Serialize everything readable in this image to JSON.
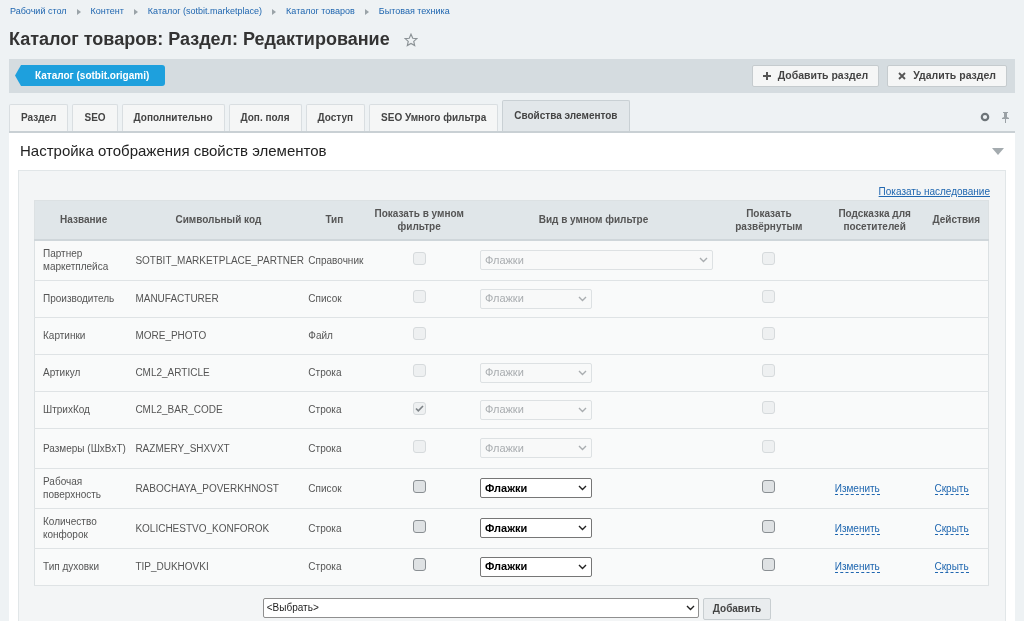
{
  "breadcrumbs": [
    "Рабочий стол",
    "Контент",
    "Каталог (sotbit.marketplace)",
    "Каталог товаров",
    "Бытовая техника"
  ],
  "title": "Каталог товаров: Раздел: Редактирование",
  "favorite": false,
  "back_button": "Каталог (sotbit.origami)",
  "toolbar_buttons": [
    {
      "kind": "add",
      "label": "Добавить раздел"
    },
    {
      "kind": "delete",
      "label": "Удалить раздел"
    }
  ],
  "tabs": [
    {
      "label": "Раздел",
      "selected": false
    },
    {
      "label": "SEO",
      "selected": false
    },
    {
      "label": "Дополнительно",
      "selected": false
    },
    {
      "label": "Доп. поля",
      "selected": false
    },
    {
      "label": "Доступ",
      "selected": false
    },
    {
      "label": "SEO Умного фильтра",
      "selected": false
    },
    {
      "label": "Свойства элементов",
      "selected": true
    }
  ],
  "section": {
    "title": "Настройка отображения свойств элементов",
    "expanded": true
  },
  "inheritance_link": "Показать наследование",
  "table": {
    "columns": [
      "Название",
      "Символьный код",
      "Тип",
      "Показать в умном фильтре",
      "Вид в умном фильтре",
      "Показать развёрнутым",
      "Подсказка для посетителей",
      "Действия"
    ],
    "rows": [
      {
        "name": "Партнер маркетплейса",
        "code": "SOTBIT_MARKETPLACE_PARTNER",
        "type": "Справочник",
        "disabled": true,
        "smart_filter": false,
        "view": {
          "kind": "wide",
          "value": "Флажки"
        },
        "expanded": false
      },
      {
        "name": "Производитель",
        "code": "MANUFACTURER",
        "type": "Список",
        "disabled": true,
        "smart_filter": false,
        "view": {
          "kind": "narrow",
          "value": "Флажки"
        },
        "expanded": false
      },
      {
        "name": "Картинки",
        "code": "MORE_PHOTO",
        "type": "Файл",
        "disabled": true,
        "smart_filter": false,
        "expanded": false
      },
      {
        "name": "Артикул",
        "code": "CML2_ARTICLE",
        "type": "Строка",
        "disabled": true,
        "smart_filter": false,
        "view": {
          "kind": "narrow",
          "value": "Флажки"
        },
        "expanded": false
      },
      {
        "name": "ШтрихКод",
        "code": "CML2_BAR_CODE",
        "type": "Строка",
        "disabled": true,
        "smart_filter": true,
        "view": {
          "kind": "narrow",
          "value": "Флажки"
        },
        "expanded": false
      },
      {
        "name": "Размеры (ШxВxТ)",
        "code": "RAZMERY_SHXVXT",
        "type": "Строка",
        "disabled": true,
        "smart_filter": false,
        "view": {
          "kind": "narrow",
          "value": "Флажки"
        },
        "expanded": false
      },
      {
        "name": "Рабочая поверхность",
        "code": "RABOCHAYA_POVERKHNOST",
        "type": "Список",
        "disabled": false,
        "smart_filter": false,
        "view": {
          "kind": "narrow",
          "value": "Флажки"
        },
        "expanded": false,
        "hint": "Изменить",
        "action": "Скрыть"
      },
      {
        "name": "Количество конфорок",
        "code": "KOLICHESTVO_KONFOROK",
        "type": "Строка",
        "disabled": false,
        "smart_filter": false,
        "view": {
          "kind": "narrow",
          "value": "Флажки"
        },
        "expanded": false,
        "hint": "Изменить",
        "action": "Скрыть"
      },
      {
        "name": "Тип духовки",
        "code": "TIP_DUKHOVKI",
        "type": "Строка",
        "disabled": false,
        "smart_filter": false,
        "view": {
          "kind": "narrow",
          "value": "Флажки"
        },
        "expanded": false,
        "hint": "Изменить",
        "action": "Скрыть"
      }
    ]
  },
  "add_property": {
    "value": "<Выбрать>",
    "button": "Добавить"
  }
}
